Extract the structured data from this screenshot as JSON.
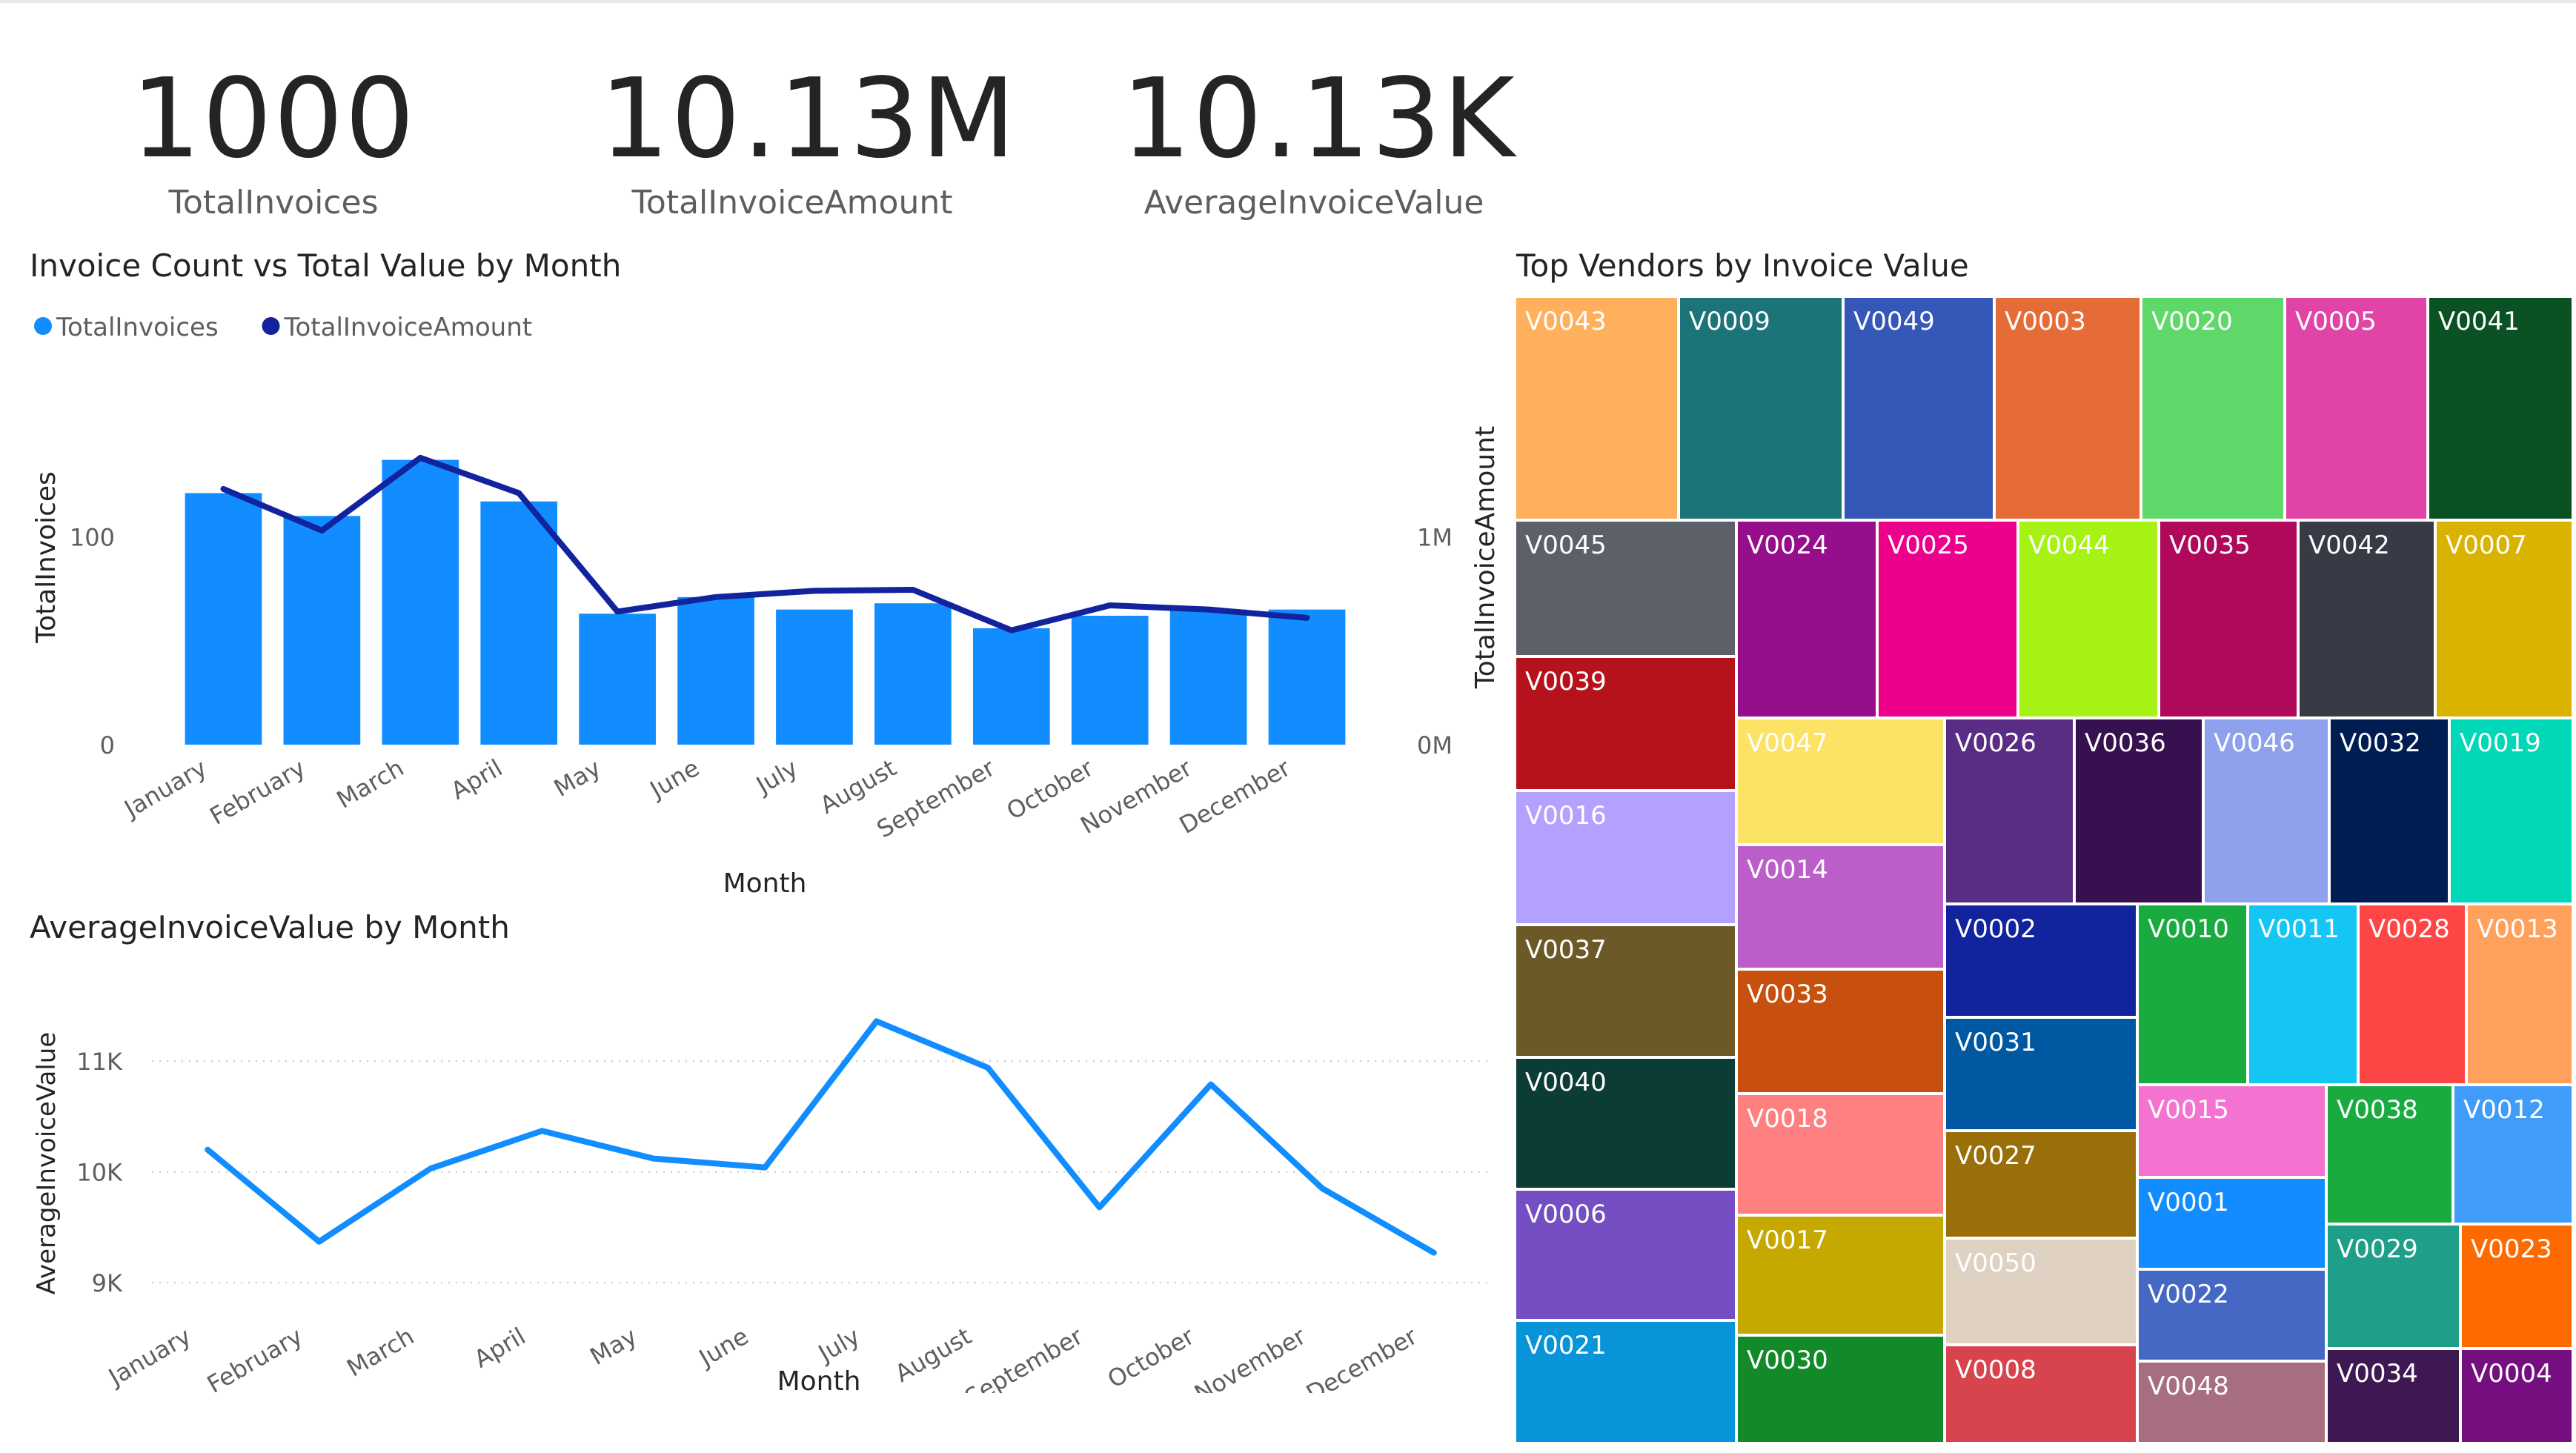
{
  "kpis": [
    {
      "value": "1000",
      "label": "TotalInvoices"
    },
    {
      "value": "10.13M",
      "label": "TotalInvoiceAmount"
    },
    {
      "value": "10.13K",
      "label": "AverageInvoiceValue"
    }
  ],
  "chart_data": [
    {
      "type": "bar",
      "title": "Invoice Count vs Total Value by Month",
      "legend": [
        {
          "name": "TotalInvoices",
          "color": "#118dff"
        },
        {
          "name": "TotalInvoiceAmount",
          "color": "#12239e"
        }
      ],
      "legend_position": "top-left",
      "categories": [
        "January",
        "February",
        "March",
        "April",
        "May",
        "June",
        "July",
        "August",
        "September",
        "October",
        "November",
        "December"
      ],
      "series": [
        {
          "name": "TotalInvoices",
          "type": "bar",
          "axis": "left",
          "color": "#118dff",
          "values": [
            121,
            110,
            137,
            117,
            63,
            71,
            65,
            68,
            56,
            62,
            65,
            65
          ]
        },
        {
          "name": "TotalInvoiceAmount",
          "type": "line",
          "axis": "right",
          "color": "#12239e",
          "values": [
            1230000,
            1030000,
            1380000,
            1210000,
            640000,
            710000,
            740000,
            745000,
            550000,
            670000,
            650000,
            610000
          ]
        }
      ],
      "xlabel": "Month",
      "ylabel": "TotalInvoices",
      "y2label": "TotalInvoiceAmount",
      "ylim": [
        0,
        180
      ],
      "y2lim": [
        0,
        1800000
      ],
      "yticks": [
        {
          "v": 0,
          "label": "0"
        },
        {
          "v": 100,
          "label": "100"
        }
      ],
      "y2ticks": [
        {
          "v": 0,
          "label": "0M"
        },
        {
          "v": 1000000,
          "label": "1M"
        }
      ],
      "grid": false
    },
    {
      "type": "line",
      "title": "AverageInvoiceValue by Month",
      "categories": [
        "January",
        "February",
        "March",
        "April",
        "May",
        "June",
        "July",
        "August",
        "September",
        "October",
        "November",
        "December"
      ],
      "series": [
        {
          "name": "AverageInvoiceValue",
          "color": "#118dff",
          "values": [
            10200,
            9370,
            10030,
            10370,
            10120,
            10040,
            11360,
            10940,
            9680,
            10790,
            9850,
            9270
          ]
        }
      ],
      "xlabel": "Month",
      "ylabel": "AverageInvoiceValue",
      "ylim": [
        8940,
        11750
      ],
      "yticks": [
        {
          "v": 9000,
          "label": "9K"
        },
        {
          "v": 10000,
          "label": "10K"
        },
        {
          "v": 11000,
          "label": "11K"
        }
      ],
      "grid": true
    },
    {
      "type": "treemap",
      "title": "Top Vendors by Invoice Value",
      "tiles": [
        {
          "label": "V0043",
          "color": "#ffb05c"
        },
        {
          "label": "V0009",
          "color": "#1b7478"
        },
        {
          "label": "V0049",
          "color": "#3457b8"
        },
        {
          "label": "V0003",
          "color": "#e66c37"
        },
        {
          "label": "V0020",
          "color": "#5fd86a"
        },
        {
          "label": "V0005",
          "color": "#e044a7"
        },
        {
          "label": "V0041",
          "color": "#0a5223"
        },
        {
          "label": "V0045",
          "color": "#5c6068"
        },
        {
          "label": "V0039",
          "color": "#b5121b"
        },
        {
          "label": "V0016",
          "color": "#b4a0ff"
        },
        {
          "label": "V0037",
          "color": "#6b5a28"
        },
        {
          "label": "V0040",
          "color": "#0b3d36"
        },
        {
          "label": "V0006",
          "color": "#744ec2"
        },
        {
          "label": "V0021",
          "color": "#0894d8"
        },
        {
          "label": "V0024",
          "color": "#960e8b"
        },
        {
          "label": "V0025",
          "color": "#ec008c"
        },
        {
          "label": "V0044",
          "color": "#a5f214"
        },
        {
          "label": "V0035",
          "color": "#b0095c"
        },
        {
          "label": "V0042",
          "color": "#363b45"
        },
        {
          "label": "V0007",
          "color": "#d9b300"
        },
        {
          "label": "V0047",
          "color": "#fce265"
        },
        {
          "label": "V0014",
          "color": "#bc5ec9"
        },
        {
          "label": "V0033",
          "color": "#c8500f"
        },
        {
          "label": "V0018",
          "color": "#ff8080"
        },
        {
          "label": "V0017",
          "color": "#c5a800"
        },
        {
          "label": "V0030",
          "color": "#138a29"
        },
        {
          "label": "V0026",
          "color": "#5a2d85"
        },
        {
          "label": "V0036",
          "color": "#37114f"
        },
        {
          "label": "V0046",
          "color": "#8fa0ec"
        },
        {
          "label": "V0032",
          "color": "#001d52"
        },
        {
          "label": "V0019",
          "color": "#00d8b8"
        },
        {
          "label": "V0002",
          "color": "#12239e"
        },
        {
          "label": "V0031",
          "color": "#0058a3"
        },
        {
          "label": "V0027",
          "color": "#9a6e08"
        },
        {
          "label": "V0050",
          "color": "#e0d2c2"
        },
        {
          "label": "V0008",
          "color": "#d8444e"
        },
        {
          "label": "V0010",
          "color": "#1aab40"
        },
        {
          "label": "V0011",
          "color": "#15c6f4"
        },
        {
          "label": "V0028",
          "color": "#ff4646"
        },
        {
          "label": "V0013",
          "color": "#ffa05c"
        },
        {
          "label": "V0015",
          "color": "#f472d0"
        },
        {
          "label": "V0001",
          "color": "#118dff"
        },
        {
          "label": "V0022",
          "color": "#4668c5"
        },
        {
          "label": "V0048",
          "color": "#a66e7e"
        },
        {
          "label": "V0038",
          "color": "#1aab40"
        },
        {
          "label": "V0012",
          "color": "#3f9cf8"
        },
        {
          "label": "V0029",
          "color": "#1f9e89"
        },
        {
          "label": "V0023",
          "color": "#ff6a00"
        },
        {
          "label": "V0034",
          "color": "#3d1852"
        },
        {
          "label": "V0004",
          "color": "#750f7f"
        }
      ]
    }
  ]
}
